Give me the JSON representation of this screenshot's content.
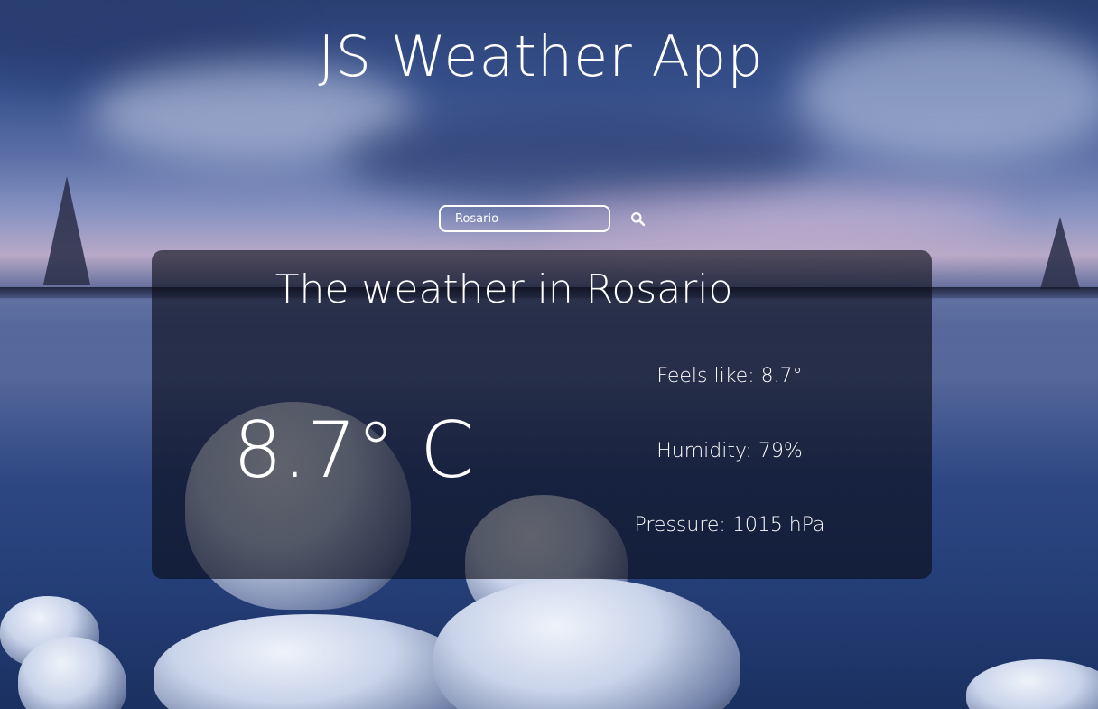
{
  "app": {
    "title": "JS Weather App"
  },
  "search": {
    "value": "Rosario",
    "icon": "search-icon"
  },
  "weather": {
    "heading": "The weather in Rosario",
    "temperature": "8.7° C",
    "feels_like": "Feels like: 8.7°",
    "humidity": "Humidity: 79%",
    "pressure": "Pressure: 1015 hPa"
  },
  "colors": {
    "card_background": "rgba(10,12,22,0.62)",
    "text": "#ffffff",
    "input_border": "#ffffff"
  }
}
